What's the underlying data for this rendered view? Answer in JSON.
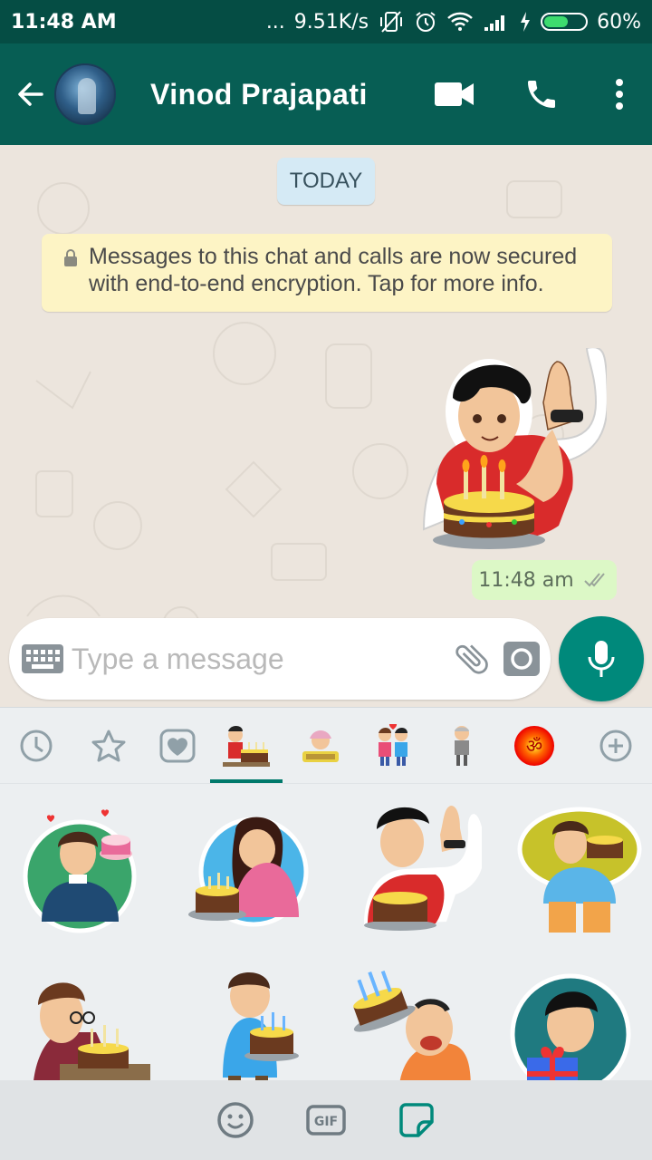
{
  "status_bar": {
    "time": "11:48 AM",
    "speed": "9.51K/s",
    "dots": "...",
    "battery": "60%",
    "battery_level": 0.6
  },
  "header": {
    "contact_name": "Vinod Prajapati",
    "icons": [
      "back-arrow-icon",
      "video-call-icon",
      "phone-icon",
      "more-vert-icon"
    ]
  },
  "chat": {
    "date_chip": "TODAY",
    "encryption_notice": "Messages to this chat and calls are now secured with end-to-end encryption. Tap for more info.",
    "messages": [
      {
        "type": "sticker",
        "sticker": "boy waving with birthday cake",
        "time": "11:48 am",
        "status": "read"
      }
    ]
  },
  "composer": {
    "placeholder": "Type a message"
  },
  "sticker_panel": {
    "tabs": [
      "recent",
      "favorites",
      "love",
      "birthday",
      "good-night",
      "couple",
      "old-man",
      "om",
      "add"
    ],
    "active_tab": "birthday",
    "stickers": [
      "man with cake and hearts",
      "girl kneeling with cake",
      "boy waving with cake",
      "man holding cake",
      "boy with glasses blowing candles",
      "boy carrying cake",
      "man with cake on head",
      "boy with gift"
    ]
  },
  "bottom_bar": {
    "gif_label": "GIF",
    "icons": [
      "emoji-icon",
      "gif-icon",
      "sticker-icon"
    ],
    "active": "sticker"
  },
  "colors": {
    "header": "#075e54",
    "status_bar": "#054d44",
    "accent": "#00897b",
    "outgoing_bubble": "#dcf8c6",
    "notice": "#fdf4c5",
    "chip": "#d5eaf5"
  }
}
